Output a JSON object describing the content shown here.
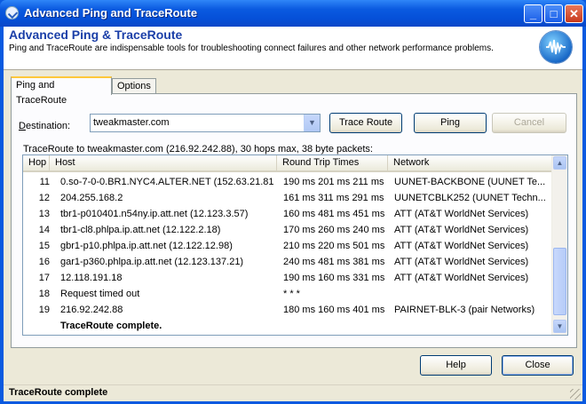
{
  "window": {
    "title": "Advanced Ping and TraceRoute",
    "minimize_glyph": "_",
    "maximize_glyph": "□",
    "close_glyph": "✕"
  },
  "header": {
    "title": "Advanced Ping & TraceRoute",
    "description": "Ping and TraceRoute are indispensable tools for troubleshooting connect failures and other network performance problems.",
    "logo_icon": "network-waveform-icon"
  },
  "tabs": [
    {
      "label": "Ping and TraceRoute",
      "active": true
    },
    {
      "label": "Options",
      "active": false
    }
  ],
  "destination": {
    "label_prefix": "D",
    "label_rest": "estination:",
    "value": "tweakmaster.com"
  },
  "buttons": {
    "trace_route": "Trace Route",
    "ping": "Ping",
    "cancel": "Cancel",
    "help": "Help",
    "close": "Close"
  },
  "trace_summary": "TraceRoute to tweakmaster.com (216.92.242.88), 30 hops max, 38 byte packets:",
  "table": {
    "columns": [
      "Hop",
      "Host",
      "Round Trip Times",
      "Network"
    ],
    "rows": [
      {
        "hop": "11",
        "host": "0.so-7-0-0.BR1.NYC4.ALTER.NET (152.63.21.81)",
        "rtt": "190 ms 201 ms 211 ms",
        "network": "UUNET-BACKBONE (UUNET Te..."
      },
      {
        "hop": "12",
        "host": "204.255.168.2",
        "rtt": "161 ms 311 ms 291 ms",
        "network": "UUNETCBLK252 (UUNET Techn..."
      },
      {
        "hop": "13",
        "host": "tbr1-p010401.n54ny.ip.att.net (12.123.3.57)",
        "rtt": "160 ms 481 ms 451 ms",
        "network": "ATT (AT&T WorldNet Services)"
      },
      {
        "hop": "14",
        "host": "tbr1-cl8.phlpa.ip.att.net (12.122.2.18)",
        "rtt": "170 ms 260 ms 240 ms",
        "network": "ATT (AT&T WorldNet Services)"
      },
      {
        "hop": "15",
        "host": "gbr1-p10.phlpa.ip.att.net (12.122.12.98)",
        "rtt": "210 ms 220 ms 501 ms",
        "network": "ATT (AT&T WorldNet Services)"
      },
      {
        "hop": "16",
        "host": "gar1-p360.phlpa.ip.att.net (12.123.137.21)",
        "rtt": "240 ms 481 ms 381 ms",
        "network": "ATT (AT&T WorldNet Services)"
      },
      {
        "hop": "17",
        "host": "12.118.191.18",
        "rtt": "190 ms 160 ms 331 ms",
        "network": "ATT (AT&T WorldNet Services)"
      },
      {
        "hop": "18",
        "host": "Request timed out",
        "rtt": "* * *",
        "network": ""
      },
      {
        "hop": "19",
        "host": "216.92.242.88",
        "rtt": "180 ms 160 ms 401 ms",
        "network": "PAIRNET-BLK-3 (pair Networks)"
      }
    ],
    "complete_message": "TraceRoute complete."
  },
  "status_bar": "TraceRoute complete"
}
